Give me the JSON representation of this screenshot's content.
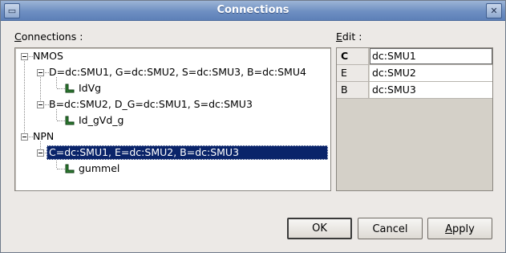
{
  "window": {
    "title": "Connections"
  },
  "labels": {
    "connections_prefix": "C",
    "connections_rest": "onnections :",
    "edit_prefix": "E",
    "edit_rest": "dit :"
  },
  "tree": {
    "groups": [
      {
        "label": "NMOS",
        "children": [
          {
            "label": "D=dc:SMU1, G=dc:SMU2, S=dc:SMU3, B=dc:SMU4",
            "leaf": "IdVg"
          },
          {
            "label": "B=dc:SMU2, D_G=dc:SMU1, S=dc:SMU3",
            "leaf": "Id_gVd_g"
          }
        ]
      },
      {
        "label": "NPN",
        "children": [
          {
            "label": "C=dc:SMU1, E=dc:SMU2, B=dc:SMU3",
            "leaf": "gummel",
            "selected": true
          }
        ]
      }
    ]
  },
  "edit_table": [
    {
      "key": "C",
      "value": "dc:SMU1"
    },
    {
      "key": "E",
      "value": "dc:SMU2"
    },
    {
      "key": "B",
      "value": "dc:SMU3"
    }
  ],
  "buttons": {
    "ok": "OK",
    "cancel": "Cancel",
    "apply_prefix": "A",
    "apply_rest": "pply"
  },
  "icons": {
    "window_menu": "window-menu-icon",
    "close": "close-icon",
    "leaf": "test-leaf-icon"
  },
  "colors": {
    "selection": "#0a246a",
    "leaf_icon": "#2e7d32"
  }
}
